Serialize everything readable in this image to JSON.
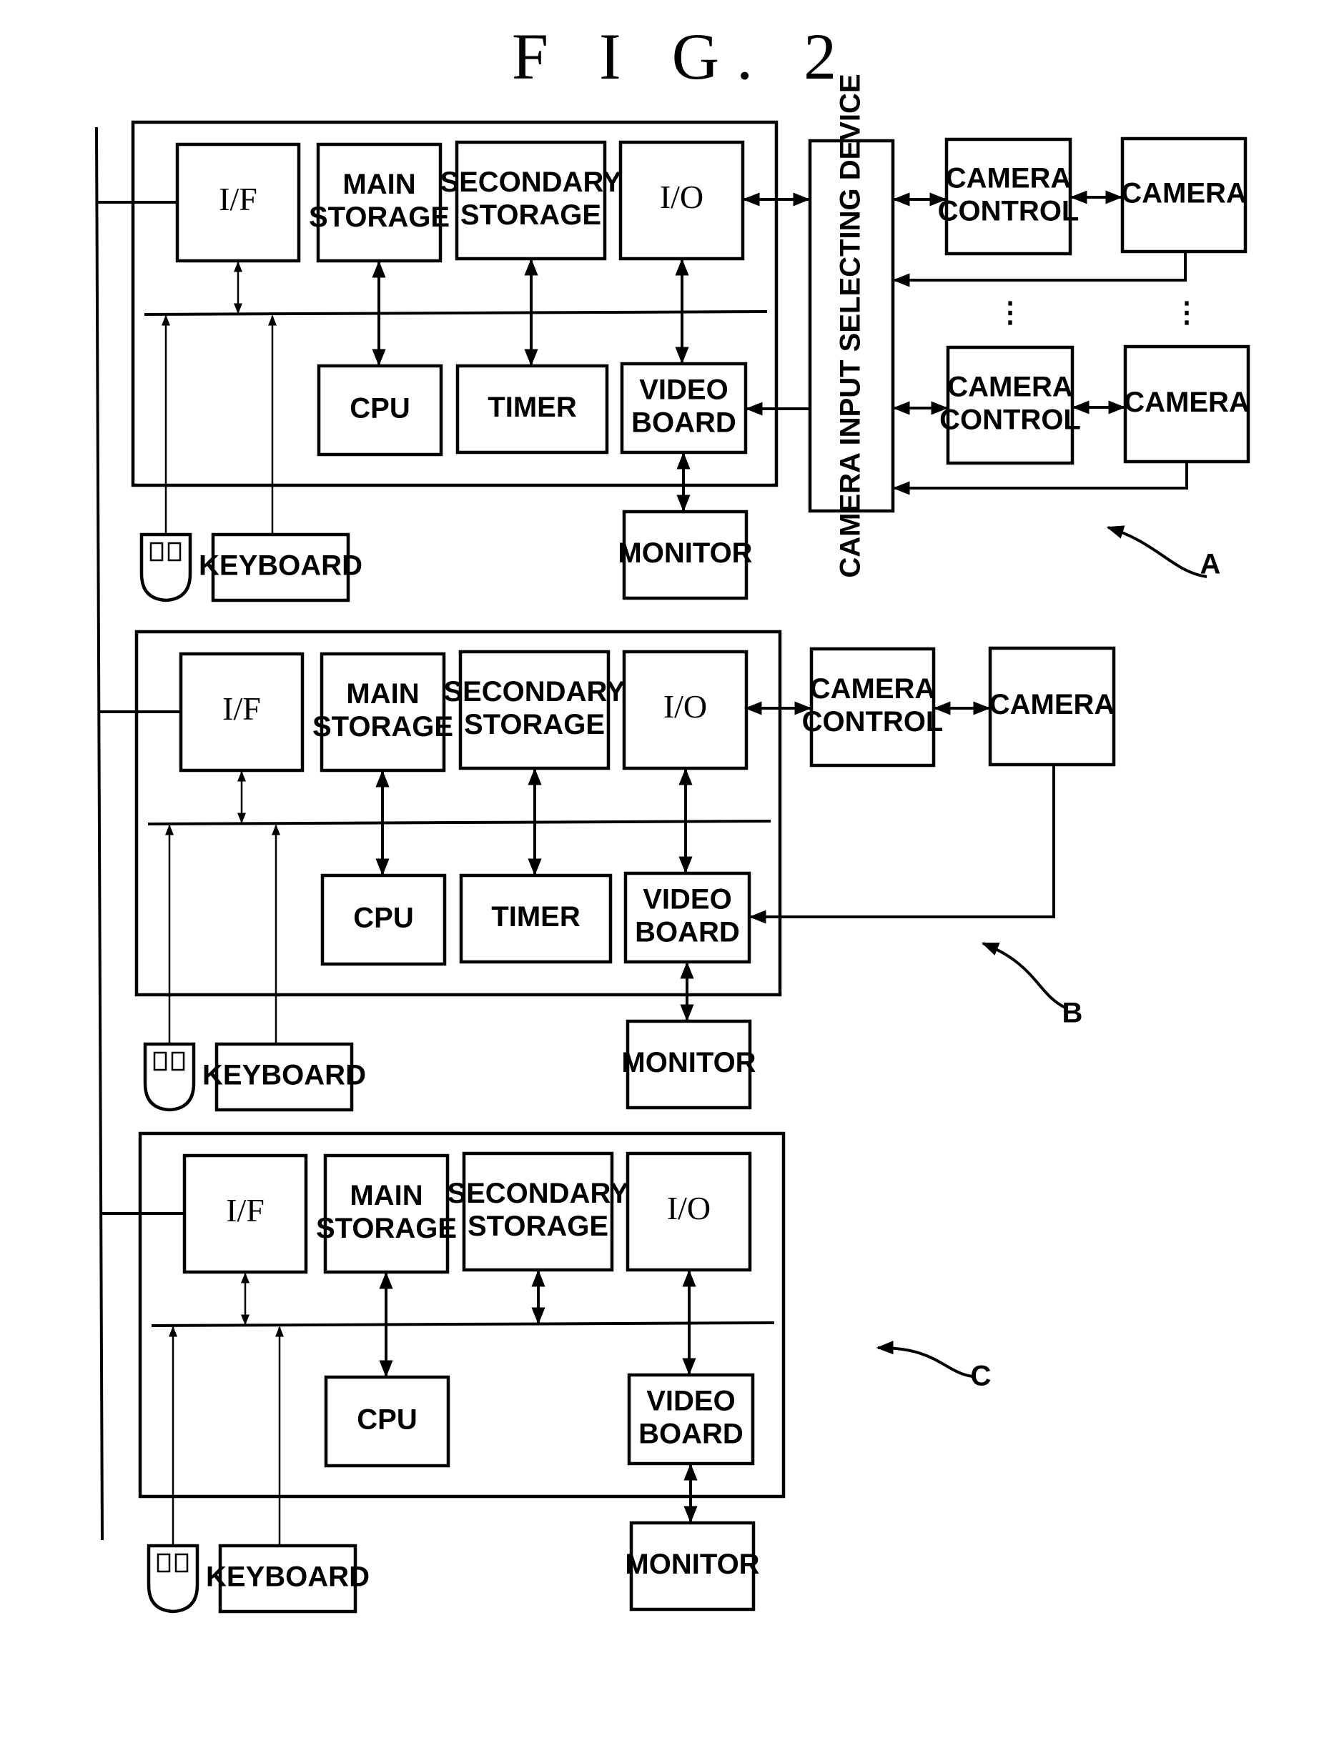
{
  "figure": {
    "title": "F I G. 2"
  },
  "labels": {
    "if": "I/F",
    "main_storage": [
      "MAIN",
      "STORAGE"
    ],
    "secondary_storage": [
      "SECONDARY",
      "STORAGE"
    ],
    "io": "I/O",
    "cpu": "CPU",
    "timer": "TIMER",
    "video_board": [
      "VIDEO",
      "BOARD"
    ],
    "monitor": "MONITOR",
    "keyboard": "KEYBOARD",
    "camera_control": [
      "CAMERA",
      "CONTROL"
    ],
    "camera": "CAMERA",
    "camera_input_selecting_device": "CAMERA INPUT SELECTING DEVICE",
    "ellipsis": "⋮"
  },
  "systems": [
    {
      "id": "A",
      "reference": "A",
      "has_timer": true,
      "camera_setup": "selector-multi"
    },
    {
      "id": "B",
      "reference": "B",
      "has_timer": true,
      "camera_setup": "direct-single"
    },
    {
      "id": "C",
      "reference": "C",
      "has_timer": false,
      "camera_setup": "none"
    }
  ]
}
